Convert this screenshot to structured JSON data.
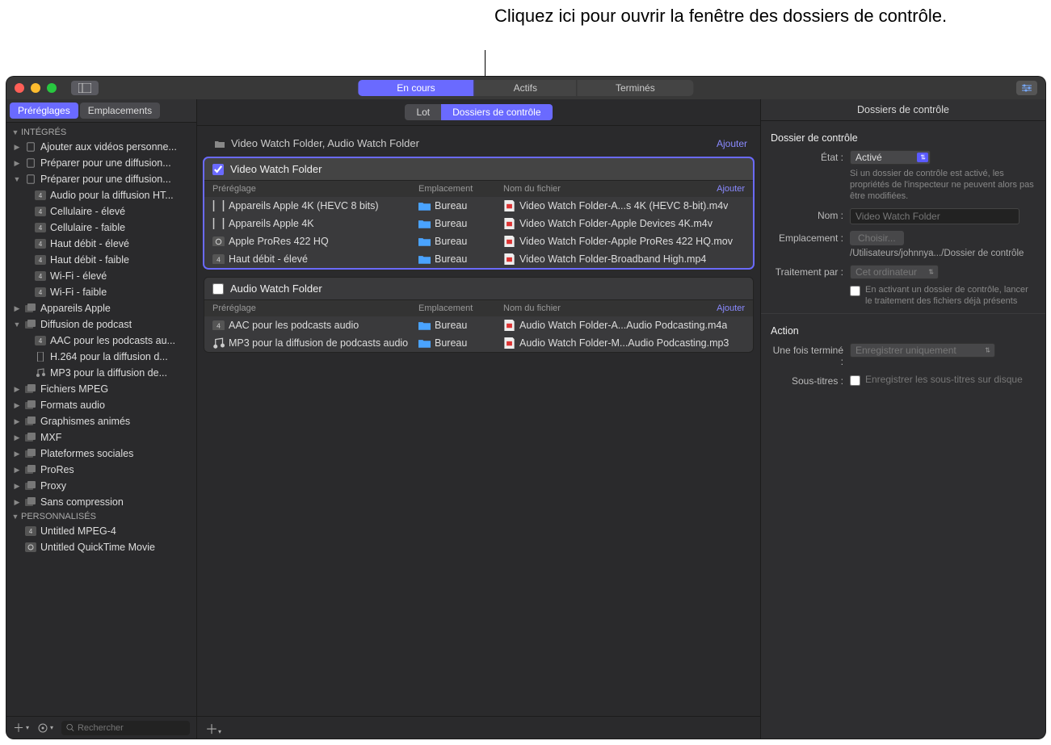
{
  "annotation": "Cliquez ici pour ouvrir la fenêtre des dossiers de contrôle.",
  "titlebar": {
    "segments": {
      "encours": "En cours",
      "actifs": "Actifs",
      "termines": "Terminés"
    }
  },
  "sidebar": {
    "tabs": {
      "presets": "Préréglages",
      "locations": "Emplacements"
    },
    "groups": {
      "integres": "INTÉGRÉS",
      "personnalises": "PERSONNALISÉS"
    },
    "items": {
      "ajouter": "Ajouter aux vidéos personne...",
      "preparer1": "Préparer pour une diffusion...",
      "preparer2": "Préparer pour une diffusion...",
      "audioht": "Audio pour la diffusion HT...",
      "celleleve": "Cellulaire - élevé",
      "cellfaible": "Cellulaire - faible",
      "hdeleve": "Haut débit - élevé",
      "hdfaible": "Haut débit - faible",
      "wifieleve": "Wi-Fi - élevé",
      "wififaible": "Wi-Fi - faible",
      "appareils": "Appareils Apple",
      "podcast": "Diffusion de podcast",
      "aac": "AAC pour les podcasts au...",
      "h264": "H.264 pour la diffusion d...",
      "mp3": "MP3 pour la diffusion de...",
      "mpeg": "Fichiers MPEG",
      "audio": "Formats audio",
      "graph": "Graphismes animés",
      "mxf": "MXF",
      "social": "Plateformes sociales",
      "prores": "ProRes",
      "proxy": "Proxy",
      "sans": "Sans compression",
      "unt1": "Untitled MPEG-4",
      "unt2": "Untitled QuickTime Movie"
    },
    "search_ph": "Rechercher"
  },
  "center": {
    "tabs": {
      "lot": "Lot",
      "dossiers": "Dossiers de contrôle"
    },
    "batch_title": "Video Watch Folder, Audio Watch Folder",
    "add": "Ajouter",
    "cols": {
      "preset": "Préréglage",
      "loc": "Emplacement",
      "file": "Nom du fichier"
    },
    "folder1": {
      "name": "Video Watch Folder",
      "checked": true,
      "rows": [
        {
          "preset": "Appareils Apple 4K (HEVC 8 bits)",
          "icon": "device",
          "loc": "Bureau",
          "file": "Video Watch Folder-A...s 4K (HEVC 8-bit).m4v"
        },
        {
          "preset": "Appareils Apple 4K",
          "icon": "device",
          "loc": "Bureau",
          "file": "Video Watch Folder-Apple Devices 4K.m4v"
        },
        {
          "preset": "Apple ProRes 422 HQ",
          "icon": "qt",
          "loc": "Bureau",
          "file": "Video Watch Folder-Apple ProRes 422 HQ.mov"
        },
        {
          "preset": "Haut débit - élevé",
          "icon": "mp4",
          "loc": "Bureau",
          "file": "Video Watch Folder-Broadband High.mp4"
        }
      ]
    },
    "folder2": {
      "name": "Audio Watch Folder",
      "checked": false,
      "rows": [
        {
          "preset": "AAC pour les podcasts audio",
          "icon": "mp4",
          "loc": "Bureau",
          "file": "Audio Watch Folder-A...Audio Podcasting.m4a"
        },
        {
          "preset": "MP3 pour la diffusion de podcasts audio",
          "icon": "music",
          "loc": "Bureau",
          "file": "Audio Watch Folder-M...Audio Podcasting.mp3"
        }
      ]
    }
  },
  "inspector": {
    "title": "Dossiers de contrôle",
    "section1": "Dossier de contrôle",
    "etat_label": "État :",
    "etat_val": "Activé",
    "etat_hint": "Si un dossier de contrôle est activé, les propriétés de l'inspecteur ne peuvent alors pas être modifiées.",
    "nom_label": "Nom :",
    "nom_val": "Video Watch Folder",
    "emp_label": "Emplacement :",
    "emp_btn": "Choisir...",
    "emp_path": "/Utilisateurs/johnnya.../Dossier de contrôle",
    "trait_label": "Traitement par :",
    "trait_val": "Cet ordinateur",
    "trait_chk": "En activant un dossier de contrôle, lancer le traitement des fichiers déjà présents",
    "section2": "Action",
    "fini_label": "Une fois terminé :",
    "fini_val": "Enregistrer uniquement",
    "st_label": "Sous-titres :",
    "st_chk": "Enregistrer les sous-titres sur disque"
  }
}
